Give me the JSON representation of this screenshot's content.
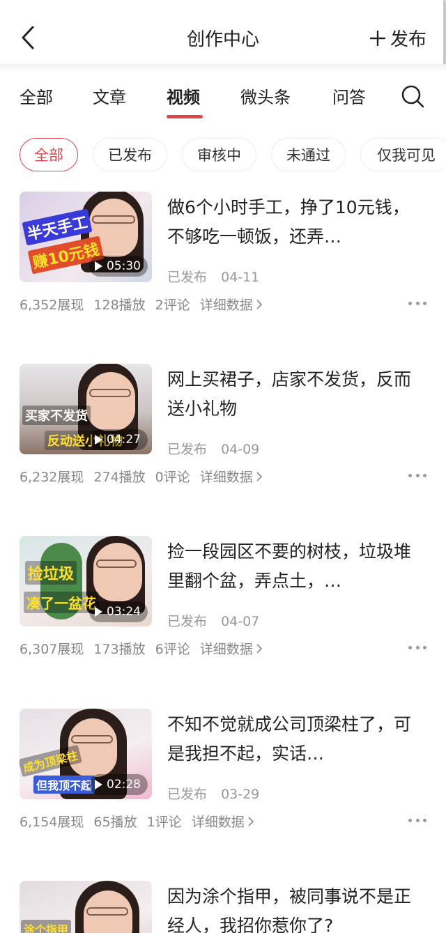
{
  "header": {
    "title": "创作中心",
    "publish_label": "发布"
  },
  "tabs": [
    {
      "label": "全部"
    },
    {
      "label": "文章"
    },
    {
      "label": "视频"
    },
    {
      "label": "微头条"
    },
    {
      "label": "问答"
    }
  ],
  "active_tab": "视频",
  "filters": [
    {
      "label": "全部"
    },
    {
      "label": "已发布"
    },
    {
      "label": "审核中"
    },
    {
      "label": "未通过"
    },
    {
      "label": "仅我可见"
    }
  ],
  "active_filter": "全部",
  "colors": {
    "accent": "#e0454a",
    "muted": "#999999"
  },
  "items": [
    {
      "title": "做6个小时手工，挣了10元钱，不够吃一顿饭，还弄…",
      "thumb_caption_1": "半天手工",
      "thumb_caption_2": "赚10元钱",
      "duration": "05:30",
      "status": "已发布",
      "date": "04-11",
      "views": "6,352展现",
      "plays": "128播放",
      "comments": "2评论",
      "detail": "详细数据"
    },
    {
      "title": "网上买裙子，店家不发货，反而送小礼物",
      "thumb_caption_1": "买家不发货",
      "thumb_caption_2": "反动送小礼物",
      "duration": "04:27",
      "status": "已发布",
      "date": "04-09",
      "views": "6,232展现",
      "plays": "274播放",
      "comments": "0评论",
      "detail": "详细数据"
    },
    {
      "title": "捡一段园区不要的树枝，垃圾堆里翻个盆，弄点土，…",
      "thumb_caption_1": "捡垃圾",
      "thumb_caption_2": "凑了一盆花",
      "duration": "03:24",
      "status": "已发布",
      "date": "04-07",
      "views": "6,307展现",
      "plays": "173播放",
      "comments": "6评论",
      "detail": "详细数据"
    },
    {
      "title": "不知不觉就成公司顶梁柱了，可是我担不起，实话…",
      "thumb_caption_1": "成为顶梁柱",
      "thumb_caption_2": "但我顶不起",
      "duration": "02:28",
      "status": "已发布",
      "date": "03-29",
      "views": "6,154展现",
      "plays": "65播放",
      "comments": "1评论",
      "detail": "详细数据"
    },
    {
      "title": "因为涂个指甲，被同事说不是正经人，我招你惹你了?",
      "thumb_caption_1": "涂个指甲",
      "thumb_caption_2": "",
      "duration": "",
      "status": "",
      "date": "",
      "views": "",
      "plays": "",
      "comments": "",
      "detail": ""
    }
  ]
}
